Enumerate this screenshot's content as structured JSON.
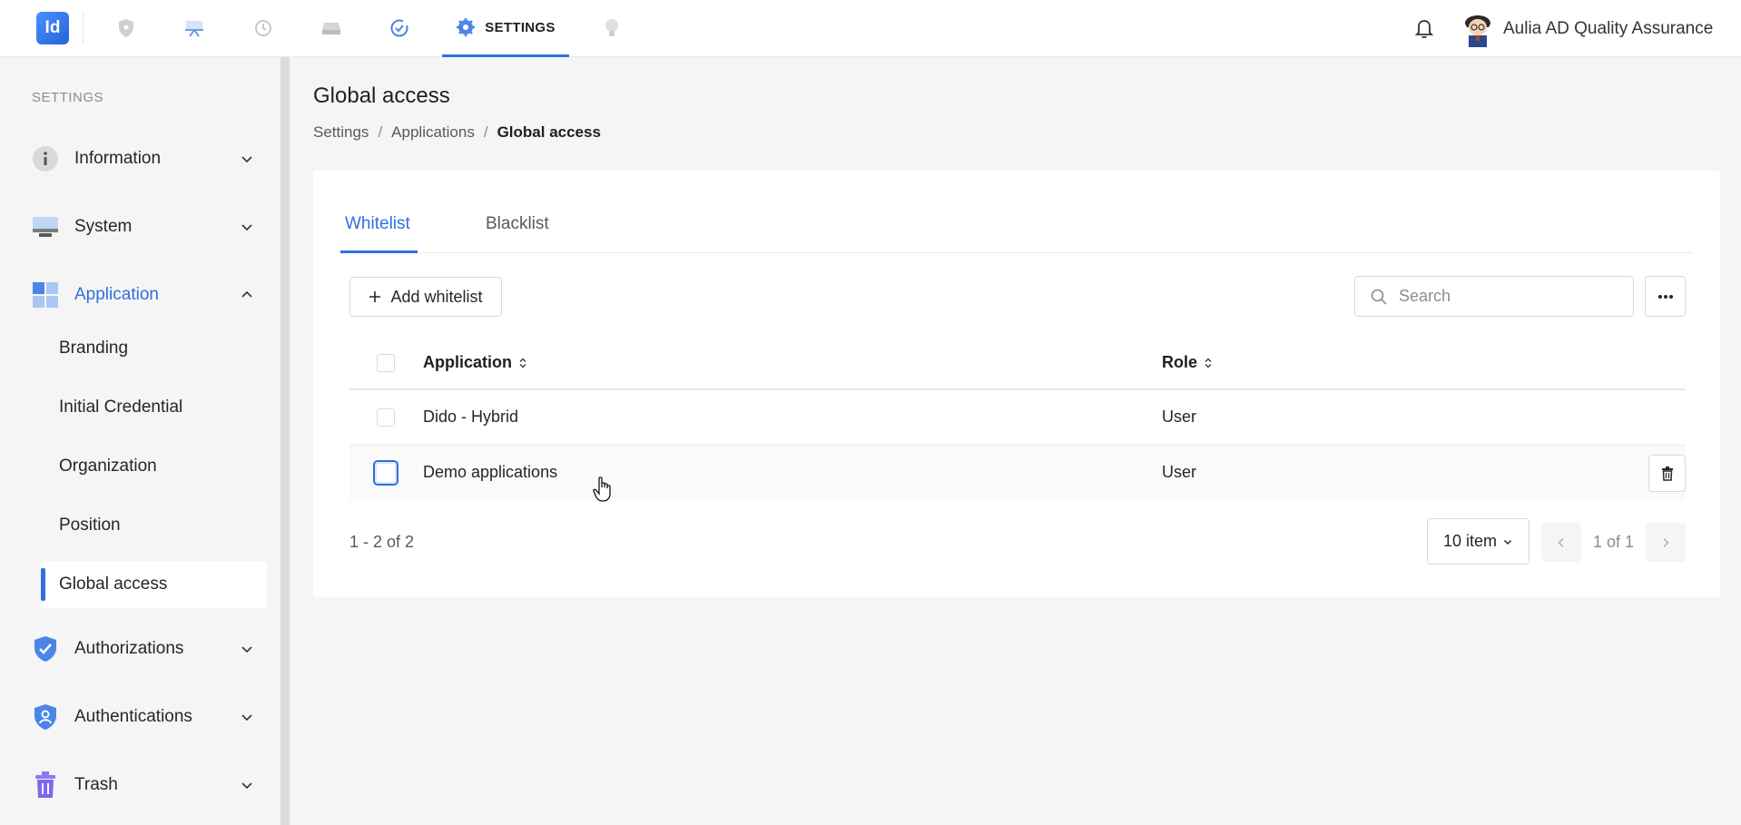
{
  "header": {
    "logo_text": "Id",
    "nav_active_label": "SETTINGS",
    "user_name": "Aulia AD Quality Assurance"
  },
  "sidebar": {
    "section_label": "SETTINGS",
    "items": [
      {
        "label": "Information",
        "icon": "info-icon"
      },
      {
        "label": "System",
        "icon": "monitor-icon"
      },
      {
        "label": "Application",
        "icon": "grid-icon"
      },
      {
        "label": "Authorizations",
        "icon": "shield-check-icon"
      },
      {
        "label": "Authentications",
        "icon": "shield-user-icon"
      },
      {
        "label": "Trash",
        "icon": "trash-icon"
      }
    ],
    "sub_items": [
      "Branding",
      "Initial Credential",
      "Organization",
      "Position",
      "Global access"
    ]
  },
  "page": {
    "title": "Global access",
    "breadcrumb": [
      "Settings",
      "Applications",
      "Global access"
    ]
  },
  "tabs": [
    "Whitelist",
    "Blacklist"
  ],
  "toolbar": {
    "add_label": "Add whitelist",
    "search_placeholder": "Search"
  },
  "table": {
    "columns": [
      "Application",
      "Role"
    ],
    "rows": [
      {
        "application": "Dido - Hybrid",
        "role": "User"
      },
      {
        "application": "Demo applications",
        "role": "User"
      }
    ]
  },
  "pagination": {
    "range": "1 - 2 of 2",
    "page_size": "10 item",
    "page_info": "1 of 1"
  },
  "colors": {
    "accent": "#2f6fe0",
    "background": "#f5f5f5"
  }
}
